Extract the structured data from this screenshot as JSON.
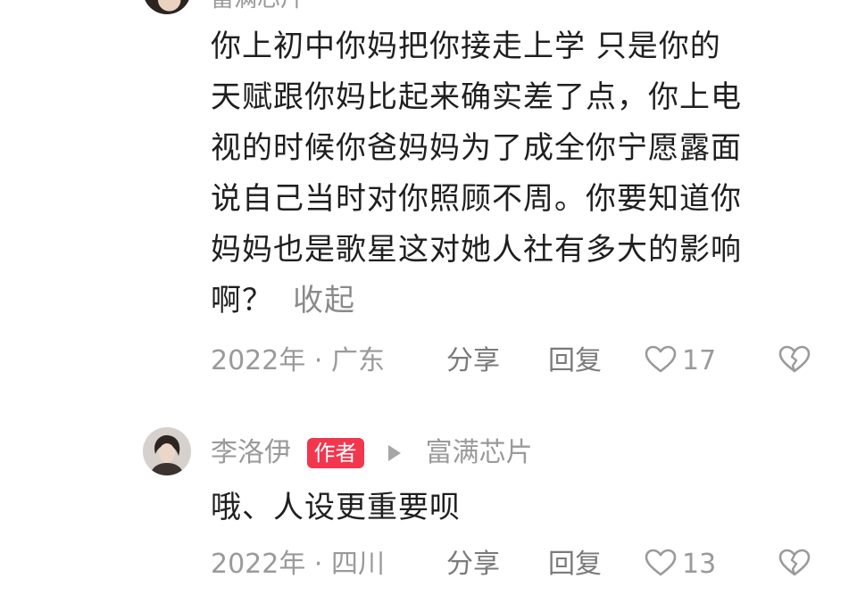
{
  "comments": [
    {
      "user_name": "富满芯片",
      "text_lines": [
        "你上初中你妈把你接走上学 只是你的",
        "天赋跟你妈比起来确实差了点，你上电",
        "视的时候你爸妈妈为了成全你宁愿露面",
        "说自己当时对你照顾不周。你要知道你",
        "妈妈也是歌星这对她人社有多大的影响",
        "啊？"
      ],
      "collapse_label": "收起",
      "time_location": "2022年 · 广东",
      "share_label": "分享",
      "reply_label": "回复",
      "like_count": "17"
    },
    {
      "user_name": "李洛伊",
      "badge": "作者",
      "reply_to": "富满芯片",
      "text": "哦、人设更重要呗",
      "time_location": "2022年 · 四川",
      "share_label": "分享",
      "reply_label": "回复",
      "like_count": "13"
    }
  ],
  "colors": {
    "text": "#1f1f1f",
    "meta": "#9a9a9a",
    "badge_bg": "#f2364e",
    "badge_text": "#ffffff"
  },
  "icons": {
    "like": "heart-outline-icon",
    "dislike": "broken-heart-icon",
    "reply_to": "triangle-right-icon"
  }
}
